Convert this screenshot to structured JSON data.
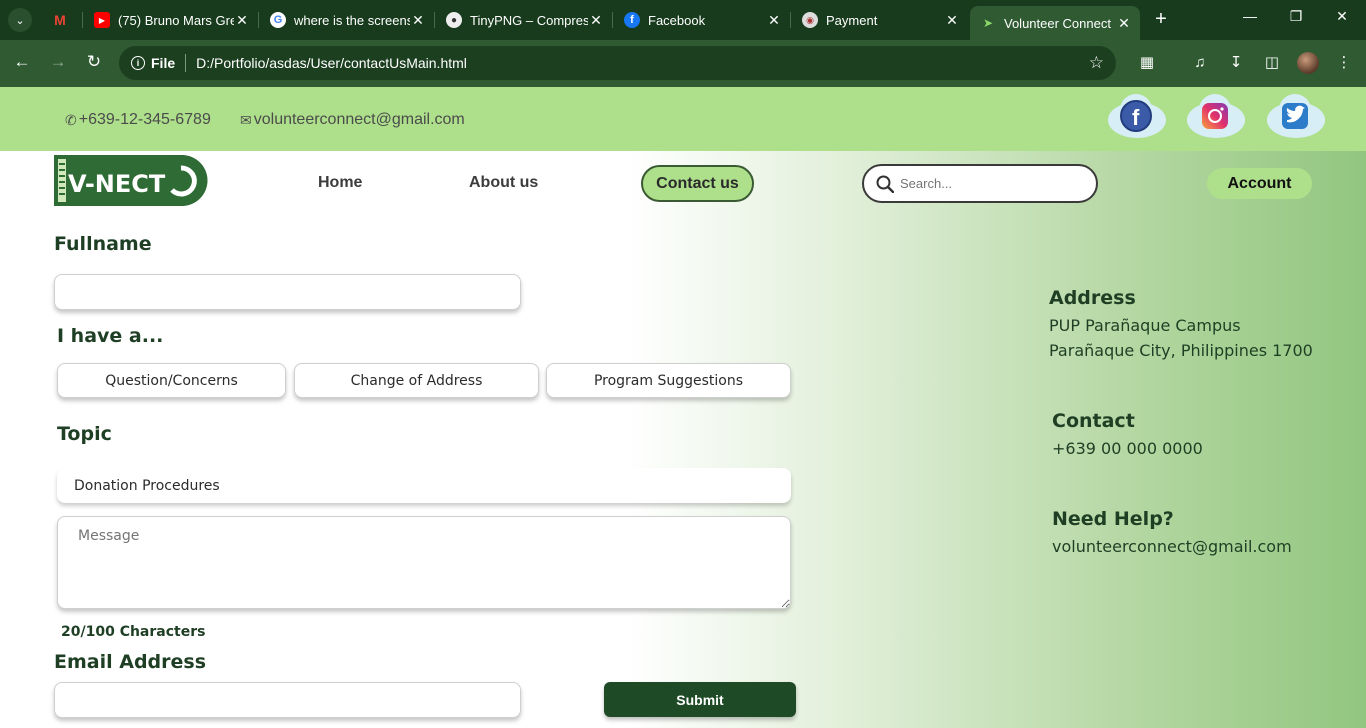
{
  "browser": {
    "tabs": [
      {
        "title": "",
        "icon": "gmail-icon"
      },
      {
        "title": "(75) Bruno Mars Gre",
        "icon": "youtube-icon"
      },
      {
        "title": "where is the screens",
        "icon": "google-icon"
      },
      {
        "title": "TinyPNG – Compres",
        "icon": "tinypng-icon"
      },
      {
        "title": "Facebook",
        "icon": "facebook-icon"
      },
      {
        "title": "Payment",
        "icon": "payment-icon"
      },
      {
        "title": "Volunteer Connect",
        "icon": "vconnect-icon",
        "active": true
      }
    ],
    "address": {
      "scheme_label": "File",
      "url": "D:/Portfolio/asdas/User/contactUsMain.html"
    }
  },
  "topbar": {
    "phone": "+639-12-345-6789",
    "email": "volunteerconnect@gmail.com",
    "social": [
      "facebook-icon",
      "instagram-icon",
      "twitter-icon"
    ]
  },
  "logo": {
    "text": "V-NECT"
  },
  "nav": {
    "home": "Home",
    "about": "About us",
    "contact": "Contact us",
    "search_placeholder": "Search...",
    "account": "Account"
  },
  "form": {
    "fullname_label": "Fullname",
    "fullname_value": "",
    "ihave_label": "I have a...",
    "options": [
      "Question/Concerns",
      "Change of Address",
      "Program Suggestions"
    ],
    "topic_label": "Topic",
    "topic_value": "Donation Procedures",
    "message_placeholder": "Message",
    "counter": "20/100 Characters",
    "email_label": "Email Address",
    "email_value": "",
    "submit": "Submit"
  },
  "info": {
    "address_title": "Address",
    "address_line1": "PUP Parañaque Campus",
    "address_line2": "Parañaque City, Philippines 1700",
    "contact_title": "Contact",
    "contact_value": "+639 00 000 0000",
    "help_title": "Need Help?",
    "help_value": "volunteerconnect@gmail.com"
  },
  "colors": {
    "accent_green": "#aee08b",
    "dark_green": "#1e4a26",
    "chrome": "#2f5a32"
  }
}
